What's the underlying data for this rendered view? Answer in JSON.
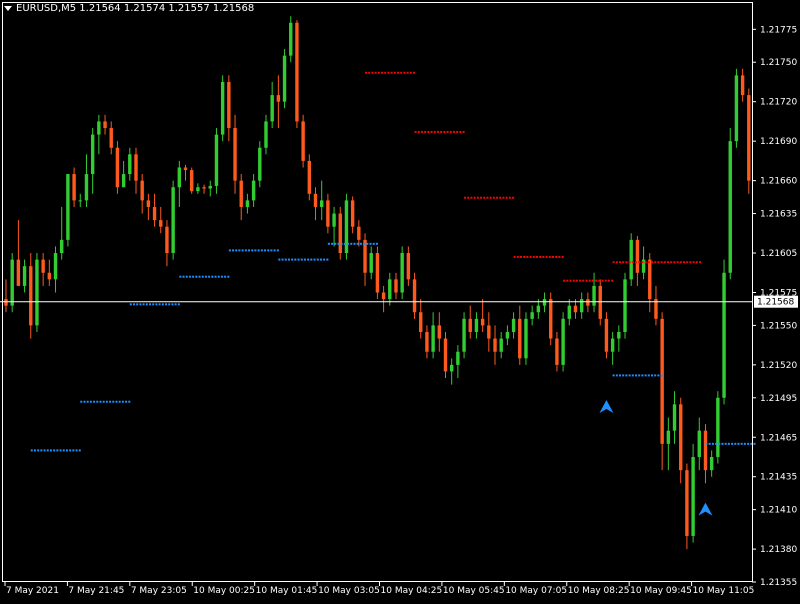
{
  "header": {
    "symbol_label": "EURUSD,M5  1.21564 1.21574 1.21557 1.21568"
  },
  "colors": {
    "background": "#000000",
    "frame": "#ffffff",
    "bull_candle": "#32cd32",
    "bear_candle": "#ff5a1e",
    "resistance_dots": "#ff0000",
    "support_dots": "#1e90ff",
    "arrow": "#1e90ff",
    "bid_line": "#ffffff",
    "text": "#ffffff"
  },
  "chart_data": {
    "type": "candlestick",
    "symbol": "EURUSD",
    "timeframe": "M5",
    "ylim": [
      1.21355,
      1.21795
    ],
    "y_ticks": [
      "1.21775",
      "1.21750",
      "1.21720",
      "1.21690",
      "1.21660",
      "1.21635",
      "1.21605",
      "1.21575",
      "1.21550",
      "1.21520",
      "1.21495",
      "1.21465",
      "1.21435",
      "1.21410",
      "1.21380",
      "1.21355"
    ],
    "current_price": "1.21568",
    "x_labels": [
      "7 May 2021",
      "7 May 21:45",
      "7 May 23:05",
      "10 May 00:25",
      "10 May 01:45",
      "10 May 03:05",
      "10 May 04:25",
      "10 May 05:45",
      "10 May 07:05",
      "10 May 08:25",
      "10 May 09:45",
      "10 May 11:05"
    ],
    "bar_count": 185,
    "candles": [
      [
        1.2157,
        1.21585,
        1.2156,
        1.21565
      ],
      [
        1.21565,
        1.21605,
        1.2156,
        1.216
      ],
      [
        1.216,
        1.2163,
        1.2159,
        1.2158
      ],
      [
        1.2158,
        1.216,
        1.21575,
        1.21595
      ],
      [
        1.21595,
        1.21605,
        1.2154,
        1.2155
      ],
      [
        1.2155,
        1.21605,
        1.21545,
        1.216
      ],
      [
        1.216,
        1.21605,
        1.2158,
        1.2159
      ],
      [
        1.2159,
        1.216,
        1.2158,
        1.21585
      ],
      [
        1.21585,
        1.2161,
        1.21575,
        1.21605
      ],
      [
        1.21605,
        1.2164,
        1.216,
        1.21615
      ],
      [
        1.21615,
        1.21665,
        1.2161,
        1.21665
      ],
      [
        1.21665,
        1.2167,
        1.2164,
        1.21645
      ],
      [
        1.21645,
        1.2165,
        1.2164,
        1.21645
      ],
      [
        1.21645,
        1.2168,
        1.2164,
        1.21665
      ],
      [
        1.21665,
        1.217,
        1.2165,
        1.21695
      ],
      [
        1.21695,
        1.2171,
        1.2168,
        1.21705
      ],
      [
        1.21705,
        1.2171,
        1.21695,
        1.217
      ],
      [
        1.217,
        1.21705,
        1.2168,
        1.21685
      ],
      [
        1.21685,
        1.2169,
        1.2165,
        1.21655
      ],
      [
        1.21655,
        1.21675,
        1.21655,
        1.21665
      ],
      [
        1.21665,
        1.21685,
        1.2166,
        1.2168
      ],
      [
        1.2168,
        1.21685,
        1.2165,
        1.2166
      ],
      [
        1.2166,
        1.21665,
        1.21635,
        1.21645
      ],
      [
        1.21645,
        1.2165,
        1.2163,
        1.2164
      ],
      [
        1.2164,
        1.2165,
        1.21625,
        1.2163
      ],
      [
        1.2163,
        1.2164,
        1.2162,
        1.21625
      ],
      [
        1.21625,
        1.2163,
        1.21595,
        1.21605
      ],
      [
        1.21605,
        1.2166,
        1.216,
        1.21655
      ],
      [
        1.21655,
        1.21675,
        1.2164,
        1.2167
      ],
      [
        1.2167,
        1.21672,
        1.2166,
        1.21668
      ],
      [
        1.21668,
        1.2167,
        1.2165,
        1.21652
      ],
      [
        1.21652,
        1.21658,
        1.2165,
        1.21655
      ],
      [
        1.21655,
        1.21657,
        1.2165,
        1.21654
      ],
      [
        1.21654,
        1.2166,
        1.21648,
        1.21656
      ],
      [
        1.21656,
        1.217,
        1.2165,
        1.21695
      ],
      [
        1.21695,
        1.2174,
        1.2169,
        1.21735
      ],
      [
        1.21735,
        1.2174,
        1.2169,
        1.217
      ],
      [
        1.217,
        1.2171,
        1.2165,
        1.2166
      ],
      [
        1.2166,
        1.21665,
        1.2163,
        1.2164
      ],
      [
        1.2164,
        1.2165,
        1.21635,
        1.21645
      ],
      [
        1.21645,
        1.21665,
        1.2164,
        1.2166
      ],
      [
        1.2166,
        1.2169,
        1.21655,
        1.21685
      ],
      [
        1.21685,
        1.2171,
        1.2168,
        1.21705
      ],
      [
        1.21705,
        1.21735,
        1.217,
        1.21725
      ],
      [
        1.21725,
        1.2174,
        1.217,
        1.2172
      ],
      [
        1.2172,
        1.2176,
        1.21715,
        1.21755
      ],
      [
        1.21755,
        1.21785,
        1.2175,
        1.2178
      ],
      [
        1.2178,
        1.21782,
        1.217,
        1.21705
      ],
      [
        1.21705,
        1.2171,
        1.2167,
        1.21675
      ],
      [
        1.21675,
        1.2168,
        1.21645,
        1.2165
      ],
      [
        1.2165,
        1.21655,
        1.2163,
        1.2164
      ],
      [
        1.2164,
        1.2166,
        1.2163,
        1.21645
      ],
      [
        1.21645,
        1.2165,
        1.2162,
        1.21625
      ],
      [
        1.21625,
        1.2164,
        1.2161,
        1.21635
      ],
      [
        1.21635,
        1.2164,
        1.216,
        1.21605
      ],
      [
        1.21605,
        1.2165,
        1.216,
        1.21645
      ],
      [
        1.21645,
        1.21648,
        1.2162,
        1.21625
      ],
      [
        1.21625,
        1.2163,
        1.2161,
        1.21615
      ],
      [
        1.21615,
        1.2162,
        1.2158,
        1.2159
      ],
      [
        1.2159,
        1.2161,
        1.21585,
        1.21605
      ],
      [
        1.21605,
        1.2161,
        1.2157,
        1.21575
      ],
      [
        1.21575,
        1.2158,
        1.2156,
        1.2157
      ],
      [
        1.2157,
        1.2159,
        1.21565,
        1.21585
      ],
      [
        1.21585,
        1.2159,
        1.2157,
        1.21575
      ],
      [
        1.21575,
        1.2161,
        1.2157,
        1.21605
      ],
      [
        1.21605,
        1.2161,
        1.2158,
        1.21585
      ],
      [
        1.21585,
        1.2159,
        1.21555,
        1.2156
      ],
      [
        1.2156,
        1.2157,
        1.2154,
        1.21545
      ],
      [
        1.21545,
        1.2155,
        1.21525,
        1.2153
      ],
      [
        1.2153,
        1.2156,
        1.21525,
        1.2155
      ],
      [
        1.2155,
        1.2156,
        1.2153,
        1.2154
      ],
      [
        1.2154,
        1.21545,
        1.2151,
        1.21515
      ],
      [
        1.21515,
        1.21525,
        1.21505,
        1.2152
      ],
      [
        1.2152,
        1.21535,
        1.2151,
        1.2153
      ],
      [
        1.2153,
        1.2156,
        1.21525,
        1.21555
      ],
      [
        1.21555,
        1.21565,
        1.2154,
        1.21545
      ],
      [
        1.21545,
        1.2156,
        1.2154,
        1.21555
      ],
      [
        1.21555,
        1.2157,
        1.21545,
        1.2155
      ],
      [
        1.2155,
        1.2156,
        1.2153,
        1.2154
      ],
      [
        1.2154,
        1.2155,
        1.2152,
        1.2153
      ],
      [
        1.2153,
        1.21545,
        1.21525,
        1.2154
      ],
      [
        1.2154,
        1.2155,
        1.21535,
        1.21545
      ],
      [
        1.21545,
        1.2156,
        1.2154,
        1.21555
      ],
      [
        1.21555,
        1.21565,
        1.2152,
        1.21525
      ],
      [
        1.21525,
        1.2156,
        1.2152,
        1.21555
      ],
      [
        1.21555,
        1.21565,
        1.2155,
        1.2156
      ],
      [
        1.2156,
        1.2157,
        1.21555,
        1.21565
      ],
      [
        1.21565,
        1.21575,
        1.2156,
        1.2157
      ],
      [
        1.2157,
        1.21575,
        1.21535,
        1.2154
      ],
      [
        1.2154,
        1.21545,
        1.21515,
        1.2152
      ],
      [
        1.2152,
        1.2156,
        1.21515,
        1.21555
      ],
      [
        1.21555,
        1.2157,
        1.2155,
        1.21565
      ],
      [
        1.21565,
        1.2157,
        1.21555,
        1.2156
      ],
      [
        1.2156,
        1.21575,
        1.21555,
        1.2157
      ],
      [
        1.2157,
        1.21575,
        1.2156,
        1.21565
      ],
      [
        1.21565,
        1.2159,
        1.2156,
        1.2158
      ],
      [
        1.2158,
        1.21585,
        1.2155,
        1.21555
      ],
      [
        1.21555,
        1.2156,
        1.21525,
        1.2153
      ],
      [
        1.2153,
        1.21545,
        1.2152,
        1.2154
      ],
      [
        1.2154,
        1.2155,
        1.2153,
        1.21545
      ],
      [
        1.21545,
        1.2159,
        1.2154,
        1.21585
      ],
      [
        1.21585,
        1.2162,
        1.2158,
        1.21615
      ],
      [
        1.21615,
        1.21618,
        1.2158,
        1.2159
      ],
      [
        1.2159,
        1.2161,
        1.21585,
        1.216
      ],
      [
        1.216,
        1.21605,
        1.2156,
        1.2157
      ],
      [
        1.2157,
        1.2158,
        1.2155,
        1.21555
      ],
      [
        1.21555,
        1.2156,
        1.2144,
        1.2146
      ],
      [
        1.2146,
        1.2148,
        1.2144,
        1.2147
      ],
      [
        1.2147,
        1.215,
        1.2146,
        1.2149
      ],
      [
        1.2149,
        1.21495,
        1.2143,
        1.2144
      ],
      [
        1.2144,
        1.21445,
        1.2138,
        1.2139
      ],
      [
        1.2139,
        1.2146,
        1.21385,
        1.2145
      ],
      [
        1.2145,
        1.2148,
        1.2144,
        1.2147
      ],
      [
        1.2147,
        1.21475,
        1.2143,
        1.2144
      ],
      [
        1.2144,
        1.21455,
        1.21435,
        1.2145
      ],
      [
        1.2145,
        1.215,
        1.21445,
        1.21495
      ],
      [
        1.21495,
        1.216,
        1.2149,
        1.2159
      ],
      [
        1.2159,
        1.217,
        1.21585,
        1.2169
      ],
      [
        1.2169,
        1.21745,
        1.21685,
        1.2174
      ],
      [
        1.2174,
        1.21745,
        1.2172,
        1.21725
      ],
      [
        1.21725,
        1.2173,
        1.2165,
        1.2166
      ]
    ],
    "resistance_levels": [
      {
        "price": 1.21742,
        "from": 58,
        "to": 66
      },
      {
        "price": 1.21697,
        "from": 66,
        "to": 74
      },
      {
        "price": 1.21647,
        "from": 74,
        "to": 82
      },
      {
        "price": 1.21602,
        "from": 82,
        "to": 90
      },
      {
        "price": 1.21584,
        "from": 90,
        "to": 98
      },
      {
        "price": 1.21598,
        "from": 98,
        "to": 112
      }
    ],
    "support_levels": [
      {
        "price": 1.21455,
        "from": 4,
        "to": 12
      },
      {
        "price": 1.21492,
        "from": 12,
        "to": 20
      },
      {
        "price": 1.21566,
        "from": 20,
        "to": 28
      },
      {
        "price": 1.21587,
        "from": 28,
        "to": 36
      },
      {
        "price": 1.21607,
        "from": 36,
        "to": 44
      },
      {
        "price": 1.216,
        "from": 44,
        "to": 52
      },
      {
        "price": 1.21612,
        "from": 52,
        "to": 60
      },
      {
        "price": 1.21512,
        "from": 98,
        "to": 106
      },
      {
        "price": 1.2146,
        "from": 113,
        "to": 121
      }
    ],
    "signal_arrows": [
      {
        "bar": 97,
        "price": 1.21488
      },
      {
        "bar": 113,
        "price": 1.2141
      }
    ]
  }
}
